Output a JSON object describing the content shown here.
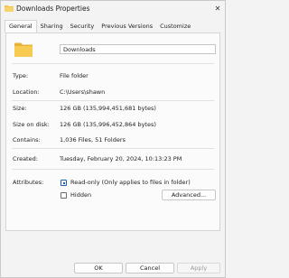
{
  "window": {
    "title": "Downloads Properties",
    "close_symbol": "✕"
  },
  "tabs": [
    {
      "label": "General",
      "active": true
    },
    {
      "label": "Sharing",
      "active": false
    },
    {
      "label": "Security",
      "active": false
    },
    {
      "label": "Previous Versions",
      "active": false
    },
    {
      "label": "Customize",
      "active": false
    }
  ],
  "general": {
    "folder_name": "Downloads",
    "folder_icon": "folder-icon",
    "folder_color": "#f4c54a",
    "properties": {
      "type": {
        "label": "Type:",
        "value": "File folder"
      },
      "location": {
        "label": "Location:",
        "value": "C:\\Users\\shawn"
      },
      "size": {
        "label": "Size:",
        "value": "126 GB (135,994,451,681 bytes)"
      },
      "size_on_disk": {
        "label": "Size on disk:",
        "value": "126 GB (135,996,452,864 bytes)"
      },
      "contains": {
        "label": "Contains:",
        "value": "1,036 Files, 51 Folders"
      },
      "created": {
        "label": "Created:",
        "value": "Tuesday, February 20, 2024, 10:13:23 PM"
      }
    },
    "attributes": {
      "label": "Attributes:",
      "read_only_label": "Read-only (Only applies to files in folder)",
      "read_only_state": "indeterminate",
      "hidden_label": "Hidden",
      "hidden_checked": false,
      "advanced_label": "Advanced..."
    }
  },
  "footer": {
    "ok_label": "OK",
    "cancel_label": "Cancel",
    "apply_label": "Apply",
    "apply_enabled": false
  }
}
